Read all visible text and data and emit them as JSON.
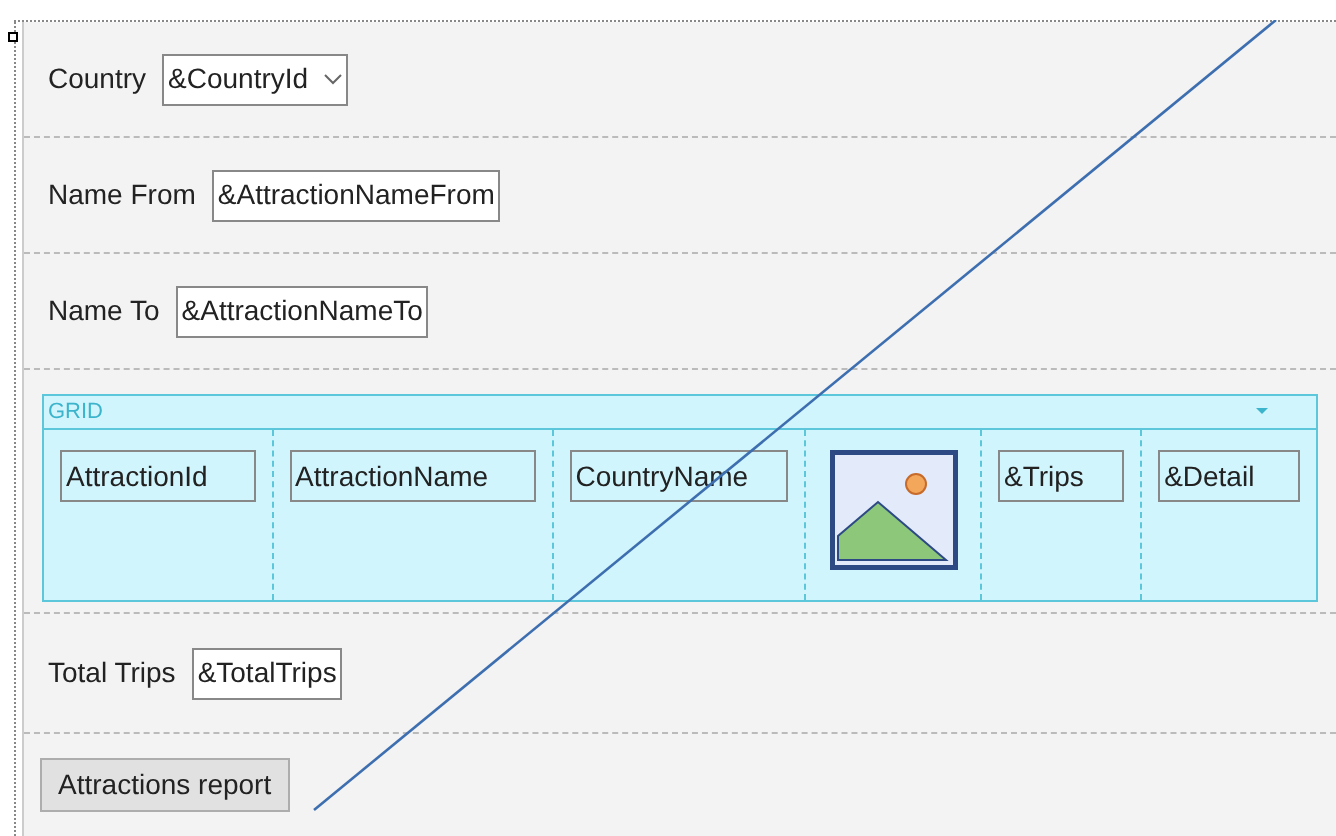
{
  "rows": [
    {
      "kind": "combo",
      "label": "Country",
      "value": "&CountryId"
    },
    {
      "kind": "text",
      "label": "Name From",
      "value": "&AttractionNameFrom"
    },
    {
      "kind": "text",
      "label": "Name To",
      "value": "&AttractionNameTo"
    }
  ],
  "grid": {
    "title": "GRID",
    "columns": [
      {
        "kind": "attribute",
        "text": "AttractionId"
      },
      {
        "kind": "attribute",
        "text": "AttractionName"
      },
      {
        "kind": "attribute",
        "text": "CountryName"
      },
      {
        "kind": "image"
      },
      {
        "kind": "attribute",
        "text": "&Trips"
      },
      {
        "kind": "attribute",
        "text": "&Detail"
      }
    ]
  },
  "total": {
    "kind": "text",
    "label": "Total Trips",
    "value": "&TotalTrips"
  },
  "button": {
    "label": "Attractions report"
  }
}
